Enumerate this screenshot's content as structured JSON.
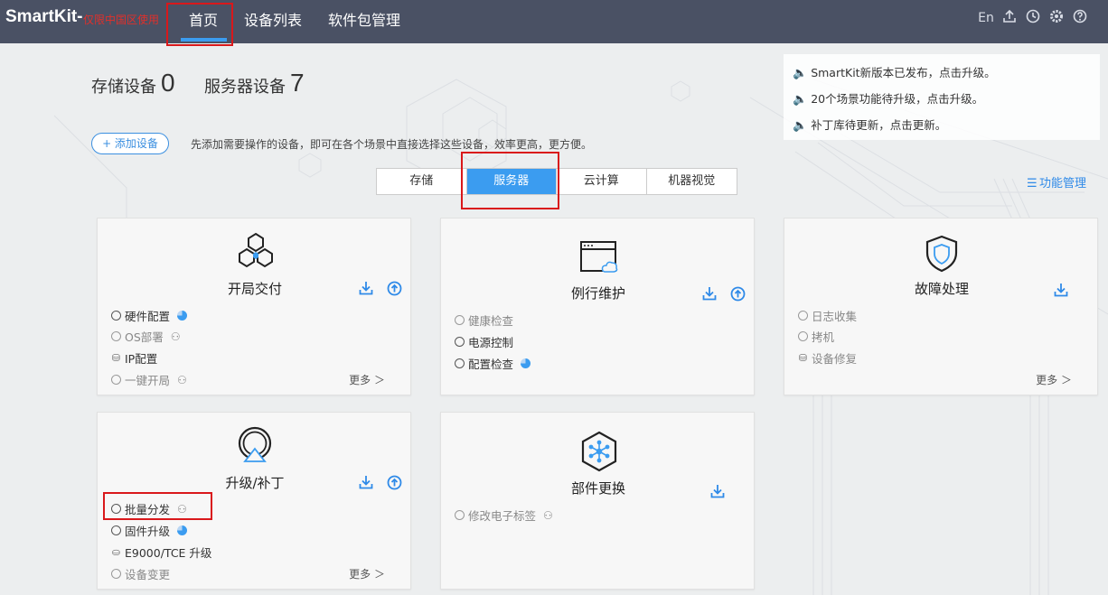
{
  "topbar": {
    "brand": "SmartKit-",
    "brand_sub": "仅限中国区使用",
    "nav": [
      "首页",
      "设备列表",
      "软件包管理"
    ],
    "icons": {
      "lang": "En",
      "upload": "upload-icon",
      "clock": "clock-icon",
      "gear": "gear-icon",
      "help": "help-icon"
    }
  },
  "counts": {
    "storage_label": "存储设备",
    "storage_value": "0",
    "server_label": "服务器设备",
    "server_value": "7"
  },
  "add_device": {
    "label": "+ 添加设备",
    "hint": "先添加需要操作的设备，即可在各个场景中直接选择这些设备，效率更高，更方便。"
  },
  "notices": [
    "SmartKit新版本已发布，点击升级。",
    "20个场景功能待升级，点击升级。",
    "补丁库待更新，点击更新。"
  ],
  "tabs": [
    "存储",
    "服务器",
    "云计算",
    "机器视觉"
  ],
  "active_tab": "服务器",
  "func_mgmt": "功能管理",
  "cards": {
    "open": {
      "title": "开局交付",
      "items": [
        "硬件配置",
        "OS部署",
        "IP配置",
        "一键开局"
      ],
      "more": "更多 ＞"
    },
    "routine": {
      "title": "例行维护",
      "items": [
        "健康检查",
        "电源控制",
        "配置检查"
      ]
    },
    "fault": {
      "title": "故障处理",
      "items": [
        "日志收集",
        "拷机",
        "设备修复"
      ],
      "more": "更多 ＞"
    },
    "upgrade": {
      "title": "升级/补丁",
      "items": [
        "批量分发",
        "固件升级",
        "E9000/TCE 升级",
        "设备变更"
      ],
      "more": "更多 ＞"
    },
    "parts": {
      "title": "部件更换",
      "items": [
        "修改电子标签"
      ]
    }
  },
  "colors": {
    "topbar": "#4a5164",
    "accent": "#3b9cf0",
    "highlight": "#d9181b"
  }
}
